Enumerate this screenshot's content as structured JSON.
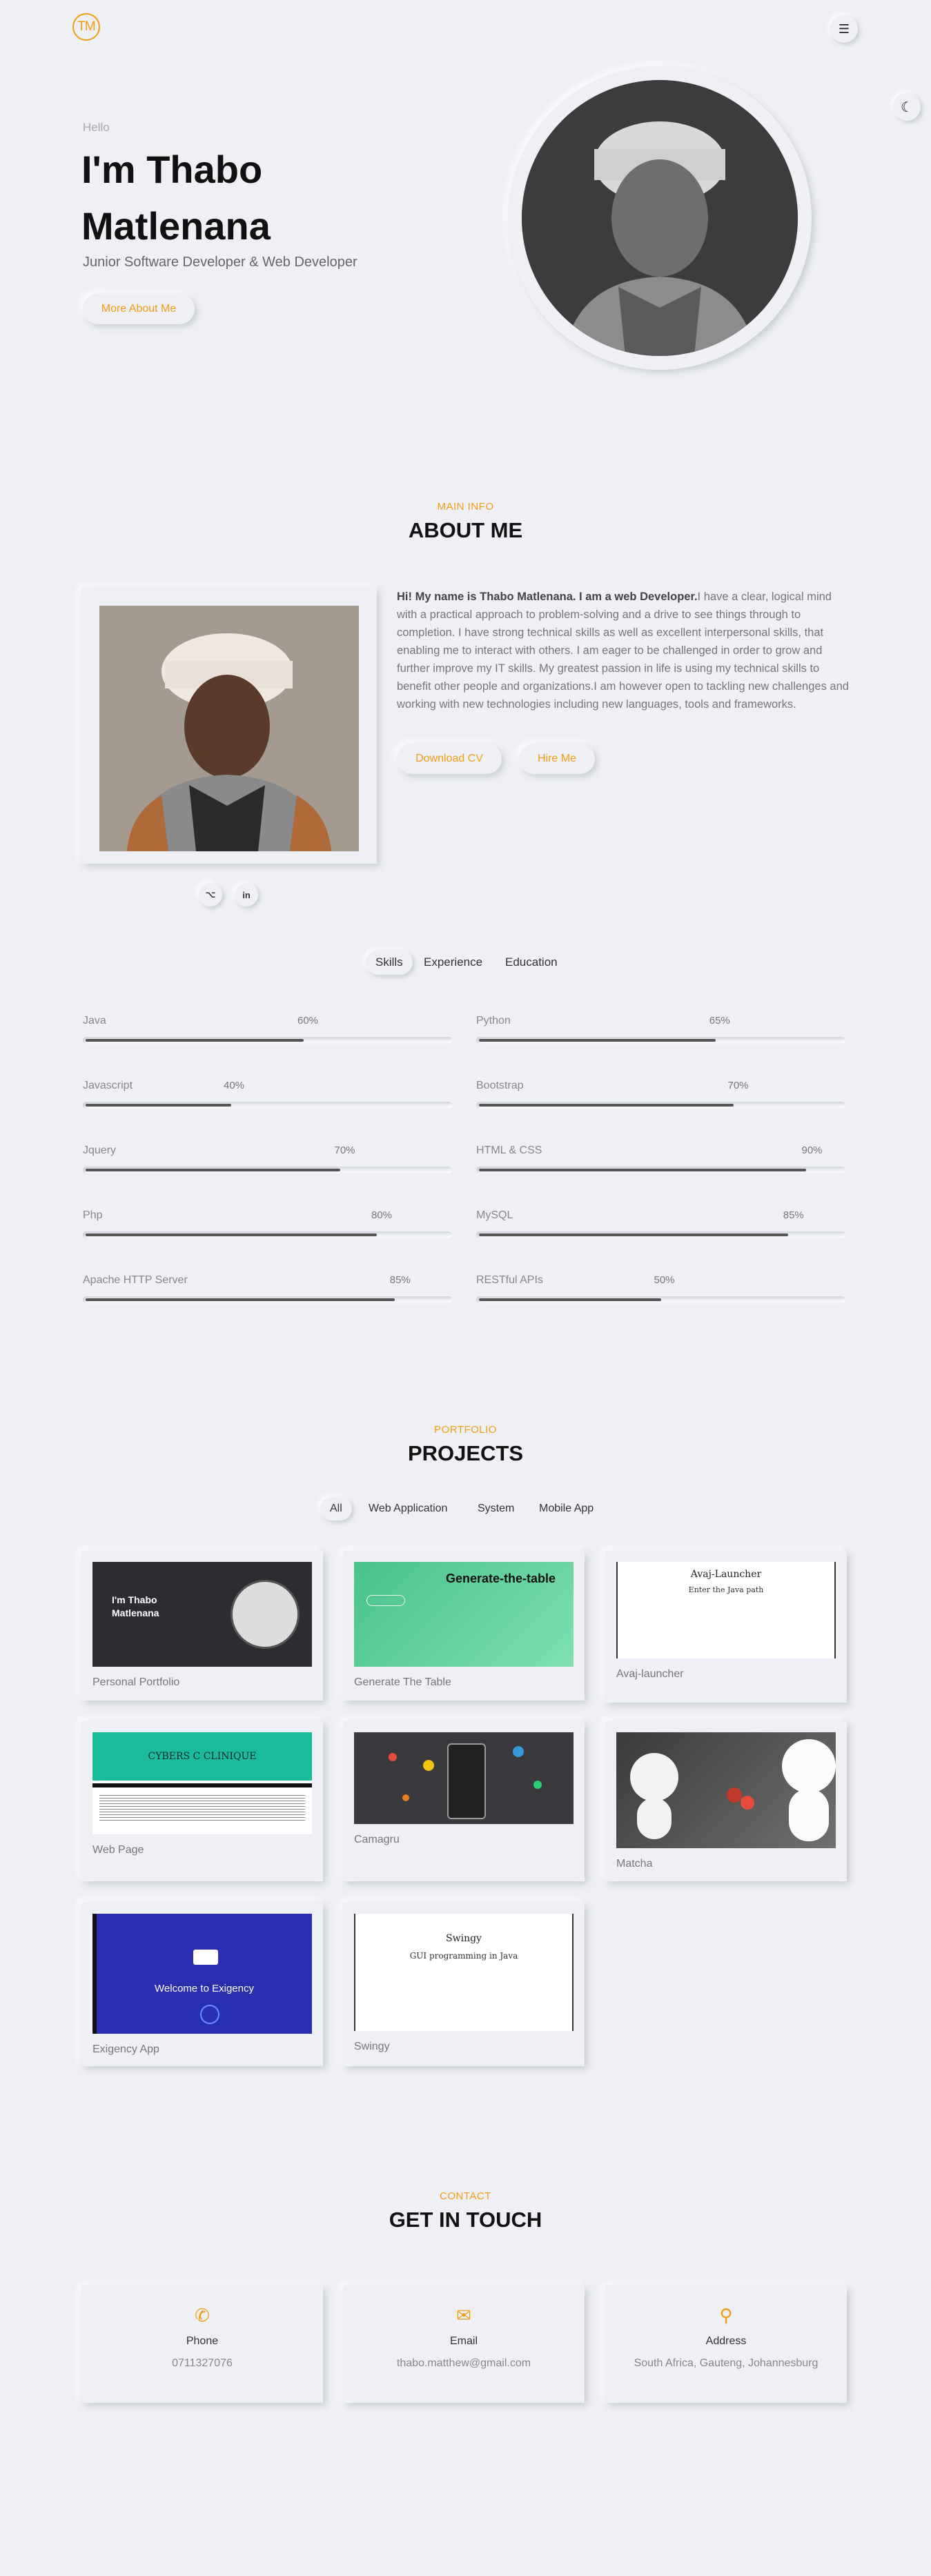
{
  "header": {
    "logo_text": "TM",
    "menu_icon": "☰",
    "theme_icon": "☾"
  },
  "hero": {
    "greeting": "Hello",
    "name": "I'm Thabo Matlenana",
    "subtitle": "Junior Software Developer & Web Developer",
    "cta": "More About Me"
  },
  "about": {
    "eyebrow": "MAIN INFO",
    "title": "ABOUT ME",
    "intro_bold": "Hi! My name is Thabo Matlenana. I am a web Developer.",
    "intro_rest": "I have a clear, logical mind with a practical approach to problem-solving and a drive to see things through to completion. I have strong technical skills as well as excellent interpersonal skills, that enabling me to interact with others. I am eager to be challenged in order to grow and further improve my IT skills. My greatest passion in life is using my technical skills to benefit other people and organizations.I am however open to tackling new challenges and working with new technologies including new languages, tools and frameworks.",
    "download_cv": "Download CV",
    "hire_me": "Hire Me",
    "social_github": "⌥",
    "social_linkedin": "in"
  },
  "skill_tabs": [
    "Skills",
    "Experience",
    "Education"
  ],
  "skills": [
    {
      "name": "Java",
      "percent_label": "60%",
      "percent": 60
    },
    {
      "name": "Python",
      "percent_label": "65%",
      "percent": 65
    },
    {
      "name": "Javascript",
      "percent_label": "40%",
      "percent": 40
    },
    {
      "name": "Bootstrap",
      "percent_label": "70%",
      "percent": 70
    },
    {
      "name": "Jquery",
      "percent_label": "70%",
      "percent": 70
    },
    {
      "name": "HTML & CSS",
      "percent_label": "90%",
      "percent": 90
    },
    {
      "name": "Php",
      "percent_label": "80%",
      "percent": 80
    },
    {
      "name": "MySQL",
      "percent_label": "85%",
      "percent": 85
    },
    {
      "name": "Apache HTTP Server",
      "percent_label": "85%",
      "percent": 85
    },
    {
      "name": "RESTful APIs",
      "percent_label": "50%",
      "percent": 50
    }
  ],
  "portfolio": {
    "eyebrow": "PORTFOLIO",
    "title": "PROJECTS",
    "filters": [
      "All",
      "Web Application",
      "System",
      "Mobile App"
    ],
    "projects": [
      {
        "caption": "Personal Portfolio",
        "thumb_title": "I'm Thabo Matlenana"
      },
      {
        "caption": "Generate The Table",
        "thumb_title": "Generate-the-table"
      },
      {
        "caption": "Avaj-launcher",
        "thumb_title": "Avaj-Launcher",
        "thumb_sub": "Enter the Java path"
      },
      {
        "caption": "Web Page",
        "thumb_title": "CYBERS C CLINIQUE"
      },
      {
        "caption": "Camagru"
      },
      {
        "caption": "Matcha"
      },
      {
        "caption": "Exigency App",
        "thumb_title": "Welcome to Exigency"
      },
      {
        "caption": "Swingy",
        "thumb_title": "Swingy",
        "thumb_sub": "GUI programming in Java"
      }
    ]
  },
  "contact": {
    "eyebrow": "CONTACT",
    "title": "GET IN TOUCH",
    "cards": [
      {
        "icon": "✆",
        "title": "Phone",
        "value": "0711327076"
      },
      {
        "icon": "✉",
        "title": "Email",
        "value": "thabo.matthew@gmail.com"
      },
      {
        "icon": "⚲",
        "title": "Address",
        "value": "South Africa, Gauteng, Johannesburg"
      }
    ]
  },
  "colors": {
    "accent": "#f39c12",
    "background": "#eef0f5"
  }
}
